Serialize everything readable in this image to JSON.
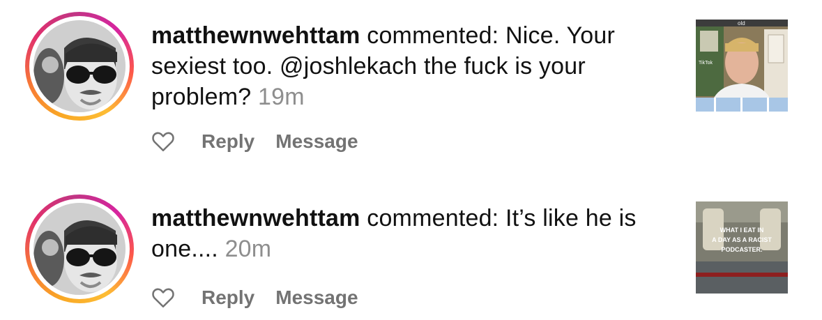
{
  "notifications": [
    {
      "username": "matthewnwehttam",
      "verb": "commented:",
      "text": "Nice. Your sexiest too. @joshlekach the fuck is your problem?",
      "time": "19m",
      "actions": {
        "reply": "Reply",
        "message": "Message"
      },
      "thumbnail": {
        "top_text": "old",
        "watermark": "TikTok"
      }
    },
    {
      "username": "matthewnwehttam",
      "verb": "commented:",
      "text": "It’s like he is one....",
      "time": "20m",
      "actions": {
        "reply": "Reply",
        "message": "Message"
      },
      "thumbnail": {
        "caption_lines": [
          "WHAT I EAT IN",
          "A DAY AS A RACIST",
          "PODCASTER."
        ]
      }
    }
  ],
  "colors": {
    "time_gray": "#8e8e8e",
    "action_gray": "#737373",
    "ring_start": "#f9a825",
    "ring_mid": "#e1306c",
    "ring_end": "#c13584"
  }
}
